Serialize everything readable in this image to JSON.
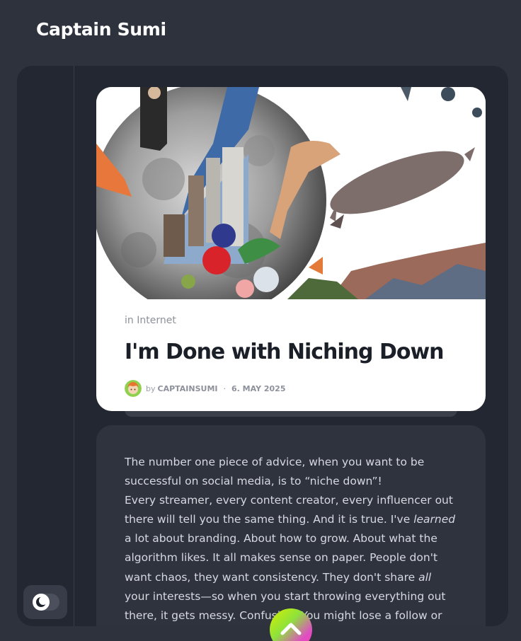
{
  "site": {
    "title": "Captain Sumi"
  },
  "post": {
    "category_prefix": "in",
    "category": "Internet",
    "title": "I'm Done with Niching Down",
    "by_label": "by",
    "author": "CAPTAINSUMI",
    "separator": "·",
    "date": "6. MAY 2025"
  },
  "content": {
    "p1": "The number one piece of advice, when you want to be successful on social media, is to “niche down”!",
    "p2a": "Every streamer, every content creator, every influencer out there will tell you the same thing. And it is true. I've ",
    "p2_em1": "learned",
    "p2b": " a lot about branding. About how to grow. About what the algorithm likes. It all makes sense on paper. People don't want chaos, they want consistency. They don't share ",
    "p2_em2": "all",
    "p2c": " your interests—so when you start throwing everything out there, it gets messy. Confusing. You might lose a follow or"
  },
  "ui": {
    "theme_icon": "moon-icon",
    "scroll_icon": "chevron-up-icon"
  }
}
